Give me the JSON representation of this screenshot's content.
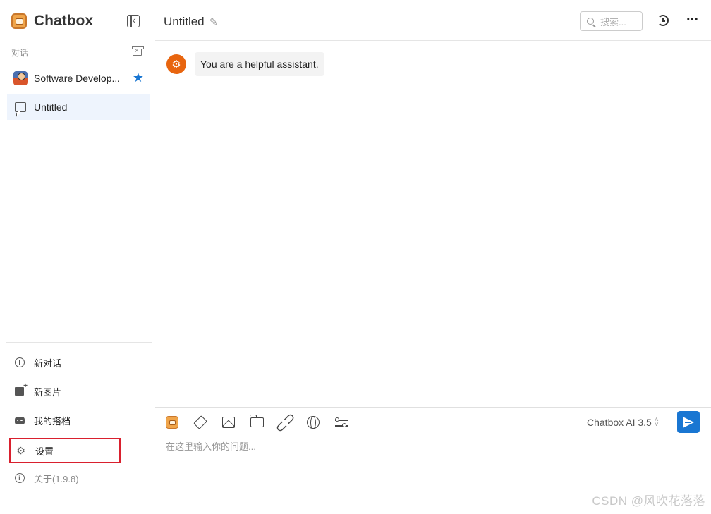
{
  "app": {
    "name": "Chatbox"
  },
  "sidebar": {
    "section_label": "对话",
    "sessions": [
      {
        "label": "Software Develop...",
        "starred": true
      },
      {
        "label": "Untitled",
        "active": true
      }
    ],
    "menu": [
      {
        "label": "新对话",
        "icon": "circle-plus-icon"
      },
      {
        "label": "新图片",
        "icon": "image-add-icon"
      },
      {
        "label": "我的搭档",
        "icon": "robot-icon"
      },
      {
        "label": "设置",
        "icon": "gear-icon",
        "highlighted": true
      },
      {
        "label": "关于(1.9.8)",
        "icon": "info-icon"
      }
    ]
  },
  "header": {
    "title": "Untitled",
    "search_placeholder": "搜索..."
  },
  "messages": [
    {
      "role": "system",
      "text": "You are a helpful assistant."
    }
  ],
  "composer": {
    "model": "Chatbox AI 3.5",
    "placeholder": "在这里输入你的问题..."
  },
  "watermark": "CSDN @风吹花落落",
  "colors": {
    "accent": "#1976d2",
    "active_session_bg": "#eef4fd",
    "system_avatar": "#e8650f",
    "highlight_border": "#d9202e"
  }
}
